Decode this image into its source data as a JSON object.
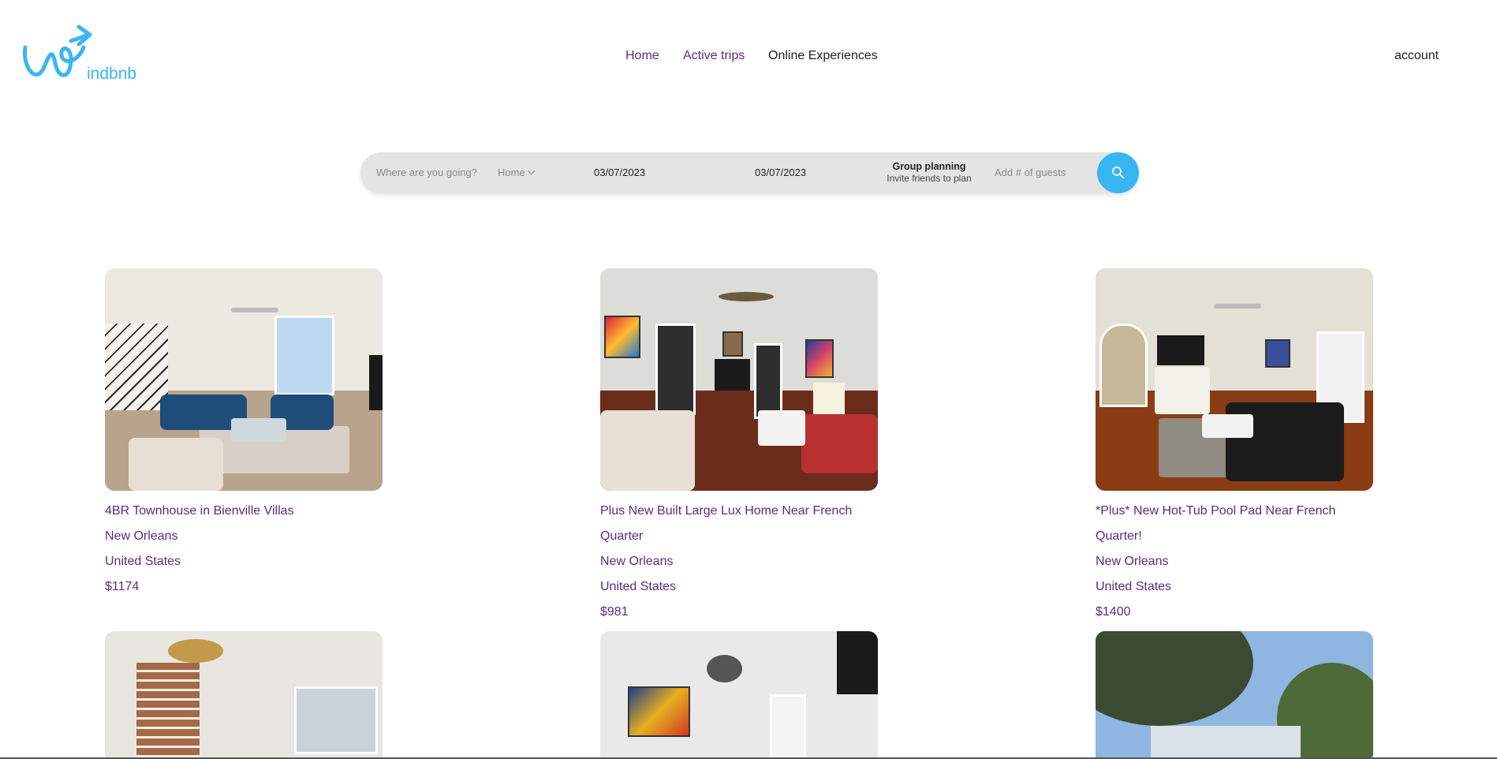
{
  "brand": {
    "name": "indbnb",
    "accent": "#38b6f2"
  },
  "nav": {
    "home": "Home",
    "active_trips": "Active trips",
    "online_experiences": "Online Experiences",
    "account": "account"
  },
  "search": {
    "where_placeholder": "Where are you going?",
    "type_value": "Home",
    "check_in": "03/07/2023",
    "check_out": "03/07/2023",
    "group_title": "Group planning",
    "group_subtitle": "Invite friends to plan",
    "guests_placeholder": "Add # of guests",
    "button_icon": "search-icon"
  },
  "listings": [
    {
      "title": "4BR Townhouse in Bienville Villas",
      "city": "New Orleans",
      "country": "United States",
      "price": "$1174"
    },
    {
      "title": "Plus New Built Large Lux Home Near French Quarter",
      "city": "New Orleans",
      "country": "United States",
      "price": "$981"
    },
    {
      "title": "*Plus* New Hot-Tub Pool Pad Near French Quarter!",
      "city": "New Orleans",
      "country": "United States",
      "price": "$1400"
    }
  ],
  "colors": {
    "link": "#5b2a86",
    "search_bg": "#e4e4e4"
  }
}
